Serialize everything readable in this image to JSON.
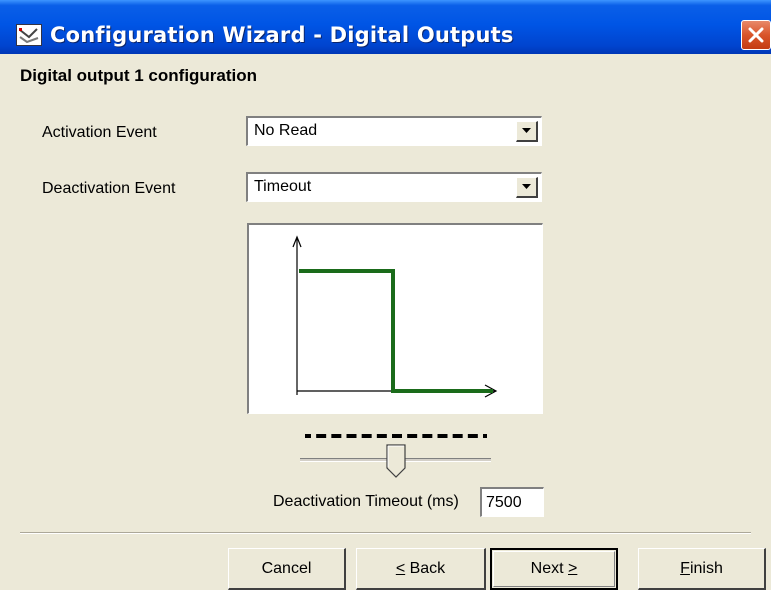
{
  "window": {
    "title": "Configuration Wizard - Digital Outputs",
    "app_icon": "wizard-app-icon",
    "close_icon": "close-icon"
  },
  "section": {
    "title": "Digital output 1 configuration"
  },
  "activation": {
    "label": "Activation Event",
    "value": "No Read"
  },
  "deactivation": {
    "label": "Deactivation Event",
    "value": "Timeout"
  },
  "graph": {
    "description_icon": "signal-waveform-diagram",
    "line_color": "#1a6b1a",
    "high_then_low": true,
    "transition_fraction": 0.5
  },
  "slider": {
    "value_ms": 7500,
    "position_fraction": 0.5,
    "tick_count": 13
  },
  "timeout": {
    "label": "Deactivation Timeout (ms)",
    "value": "7500"
  },
  "buttons": {
    "cancel": "Cancel",
    "back_mnemonic": "<",
    "back_rest": " Back",
    "next_text": "Next ",
    "next_mnemonic": ">",
    "finish_mnemonic": "F",
    "finish_rest": "inish"
  }
}
